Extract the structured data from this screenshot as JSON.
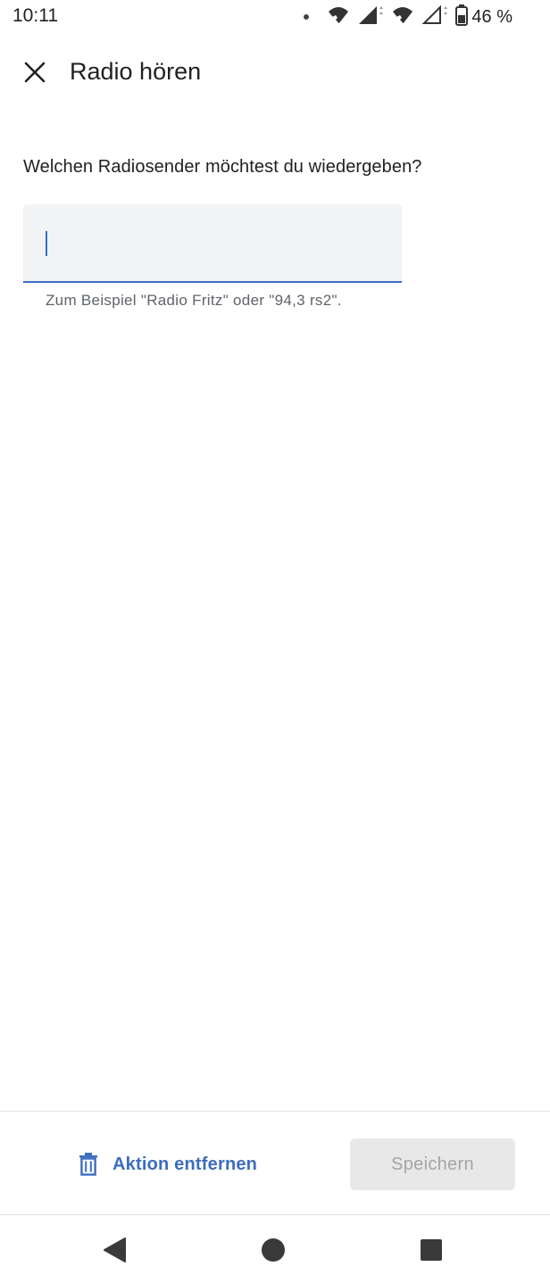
{
  "status_bar": {
    "time": "10:11",
    "battery": "46 %",
    "icons": [
      "notification-dot-icon",
      "wifi-call-icon",
      "signal-icon",
      "wifi-call-icon",
      "signal-icon",
      "battery-icon"
    ]
  },
  "app_bar": {
    "title": "Radio hören",
    "close_icon": "close-icon"
  },
  "content": {
    "question": "Welchen Radiosender möchtest du wiedergeben?",
    "input_value": "",
    "helper_text": "Zum Beispiel \"Radio Fritz\" oder \"94,3 rs2\"."
  },
  "actions": {
    "remove_label": "Aktion entfernen",
    "remove_icon": "trash-icon",
    "save_label": "Speichern"
  },
  "navigation": {
    "buttons": [
      "back-icon",
      "home-icon",
      "recents-icon"
    ]
  },
  "colors": {
    "accent": "#3c6dbf",
    "input_bg": "#f1f3f4",
    "disabled_bg": "#e8e8e8",
    "disabled_text": "#a5a5a5"
  }
}
